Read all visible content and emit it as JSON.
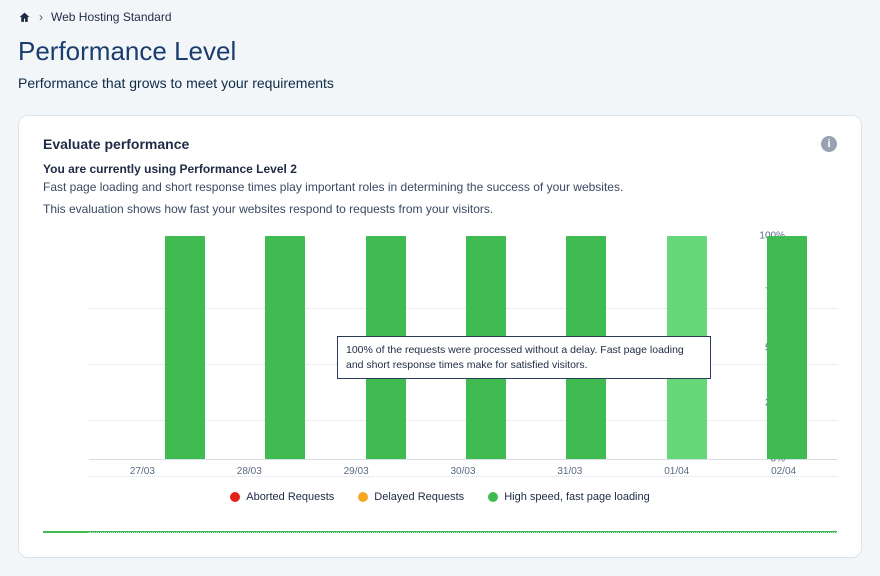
{
  "breadcrumb": {
    "page": "Web Hosting Standard"
  },
  "header": {
    "title": "Performance Level",
    "subtitle": "Performance that grows to meet your requirements"
  },
  "card": {
    "title": "Evaluate performance",
    "level_line": "You are currently using Performance Level 2",
    "desc1": "Fast page loading and short response times play important roles in determining the success of your websites.",
    "desc2": "This evaluation shows how fast your websites respond to requests from your visitors.",
    "info_glyph": "i"
  },
  "tooltip": {
    "text": "100% of the requests were processed without a delay. Fast page loading and short response times make for satisfied visitors."
  },
  "legend": {
    "aborted": "Aborted Requests",
    "delayed": "Delayed Requests",
    "fast": "High speed, fast page loading"
  },
  "chart_data": {
    "type": "bar",
    "title": "",
    "xlabel": "",
    "ylabel": "",
    "ylim": [
      0,
      100
    ],
    "y_ticks": [
      "0%",
      "25%",
      "50%",
      "75%",
      "100%"
    ],
    "y_tick_values": [
      0,
      25,
      50,
      75,
      100
    ],
    "categories": [
      "27/03",
      "28/03",
      "29/03",
      "30/03",
      "31/03",
      "01/04",
      "02/04"
    ],
    "series": [
      {
        "name": "Aborted Requests",
        "color": "#e32219",
        "values": [
          0,
          0,
          0,
          0,
          0,
          0,
          0
        ]
      },
      {
        "name": "Delayed Requests",
        "color": "#f5a623",
        "values": [
          0,
          0,
          0,
          0,
          0,
          0,
          0
        ]
      },
      {
        "name": "High speed, fast page loading",
        "color": "#3fbb52",
        "values": [
          100,
          100,
          100,
          100,
          100,
          100,
          100
        ]
      }
    ],
    "highlight_index": 5
  }
}
